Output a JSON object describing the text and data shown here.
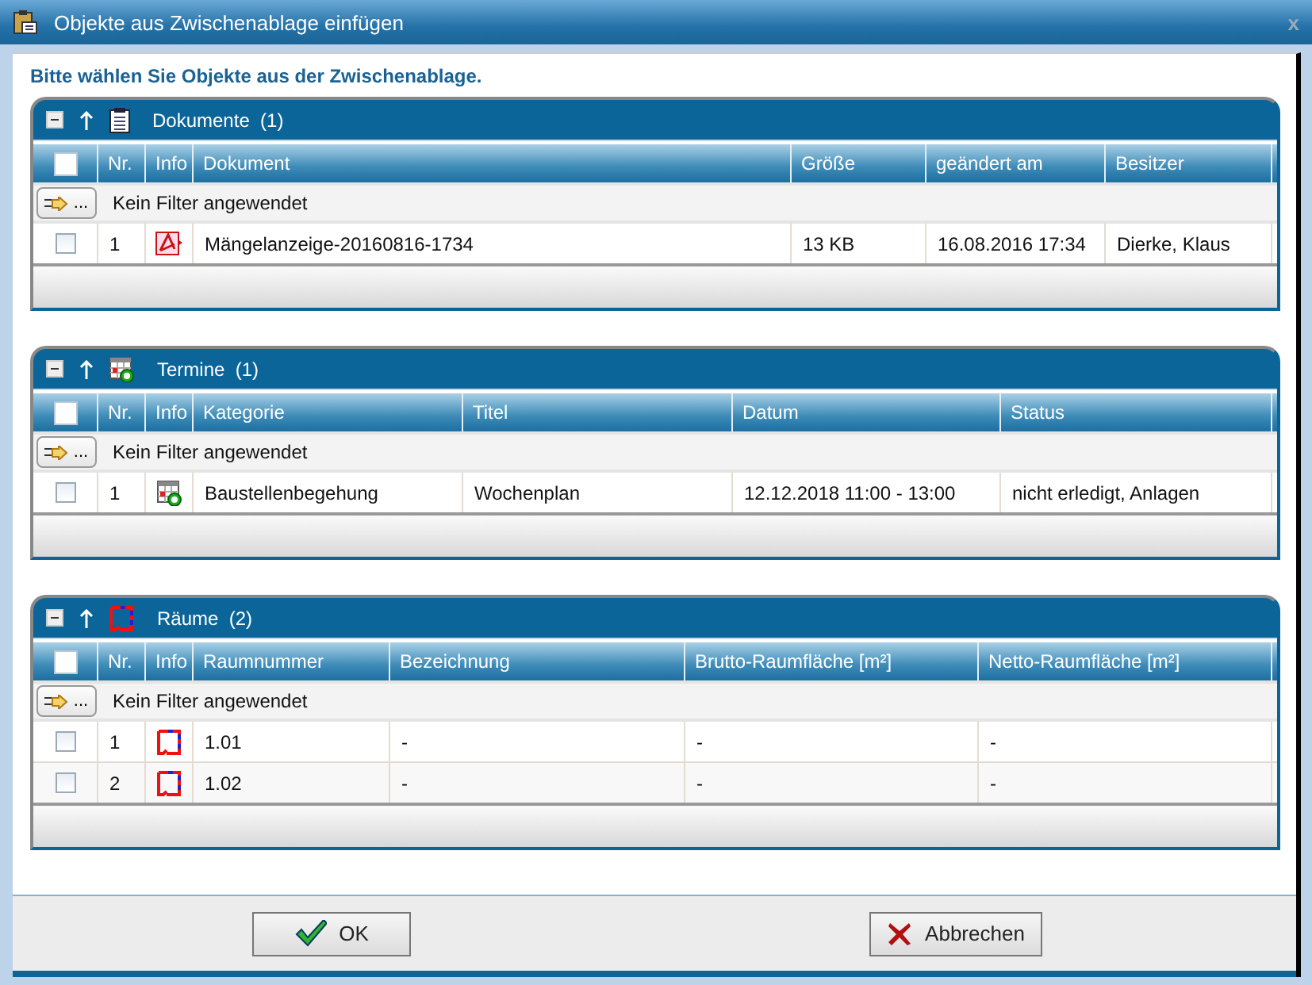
{
  "window": {
    "title": "Objekte aus Zwischenablage einfügen",
    "close": "x"
  },
  "instruction": "Bitte wählen Sie Objekte aus der Zwischenablage.",
  "sections": [
    {
      "kind": "document",
      "title": "Dokumente",
      "count": "(1)",
      "filter_button": "...",
      "filter": "Kein Filter angewendet",
      "select_all_checked": false,
      "nr_header": "Nr.",
      "info_header": "Info",
      "columns": [
        "Dokument",
        "Größe",
        "geändert am",
        "Besitzer"
      ],
      "rows": [
        {
          "checked": false,
          "nr": "1",
          "kind": "pdf",
          "cells": [
            "Mängelanzeige-20160816-1734",
            "13 KB",
            "16.08.2016 17:34",
            "Dierke, Klaus"
          ]
        }
      ]
    },
    {
      "kind": "appointment",
      "title": "Termine",
      "count": "(1)",
      "filter_button": "...",
      "filter": "Kein Filter angewendet",
      "select_all_checked": false,
      "nr_header": "Nr.",
      "info_header": "Info",
      "columns": [
        "Kategorie",
        "Titel",
        "Datum",
        "Status"
      ],
      "rows": [
        {
          "checked": false,
          "nr": "1",
          "kind": "appointment",
          "cells": [
            "Baustellenbegehung",
            "Wochenplan",
            "12.12.2018 11:00 - 13:00",
            "nicht erledigt, Anlagen"
          ]
        }
      ]
    },
    {
      "kind": "room",
      "title": "Räume",
      "count": "(2)",
      "filter_button": "...",
      "filter": "Kein Filter angewendet",
      "select_all_checked": false,
      "nr_header": "Nr.",
      "info_header": "Info",
      "columns": [
        "Raumnummer",
        "Bezeichnung",
        "Brutto-Raumfläche [m²]",
        "Netto-Raumfläche [m²]"
      ],
      "rows": [
        {
          "checked": false,
          "nr": "1",
          "kind": "room",
          "cells": [
            "1.01",
            "-",
            "-",
            "-"
          ]
        },
        {
          "checked": false,
          "nr": "2",
          "kind": "room",
          "cells": [
            "1.02",
            "-",
            "-",
            "-"
          ]
        }
      ]
    }
  ],
  "buttons": [
    {
      "kind": "ok",
      "label": "OK"
    },
    {
      "kind": "cancel",
      "label": "Abbrechen"
    }
  ]
}
